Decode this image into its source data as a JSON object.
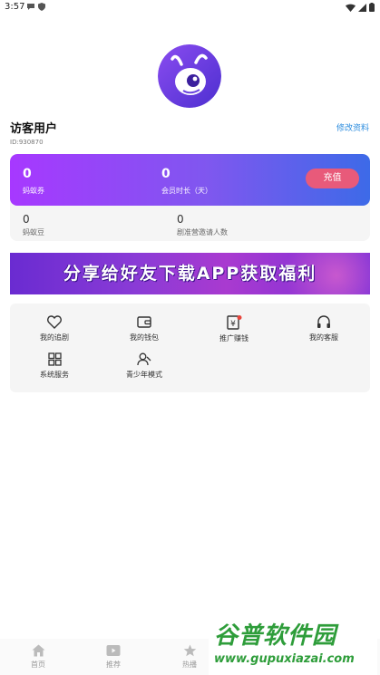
{
  "status_bar": {
    "time": "3:57"
  },
  "profile": {
    "username": "访客用户",
    "user_id": "ID:930870",
    "edit_label": "修改资料"
  },
  "stats": {
    "coupons_value": "0",
    "coupons_label": "蚂蚁券",
    "member_value": "0",
    "member_label": "会员时长（天）",
    "recharge_label": "充值",
    "beans_value": "0",
    "beans_label": "蚂蚁豆",
    "invites_value": "0",
    "invites_label": "剧准营邀请人数"
  },
  "banner": {
    "text": "分享给好友下载APP获取福利"
  },
  "features": [
    {
      "label": "我的追剧",
      "icon": "heart-icon"
    },
    {
      "label": "我的钱包",
      "icon": "wallet-icon"
    },
    {
      "label": "推广赚钱",
      "icon": "yuan-icon"
    },
    {
      "label": "我的客服",
      "icon": "headphones-icon"
    },
    {
      "label": "系统服务",
      "icon": "grid-icon"
    },
    {
      "label": "青少年模式",
      "icon": "youth-icon"
    }
  ],
  "bottom_nav": [
    {
      "label": "首页",
      "icon": "home-icon"
    },
    {
      "label": "推荐",
      "icon": "play-icon"
    },
    {
      "label": "热播",
      "icon": "star-icon"
    }
  ],
  "watermark": {
    "title": "谷普软件园",
    "url": "www.gupuxiazai.com"
  },
  "colors": {
    "accent_purple": "#a738ff",
    "accent_blue": "#3d6ae8",
    "recharge": "#e85a7a",
    "link": "#2b8cde",
    "badge": "#e8453c"
  }
}
